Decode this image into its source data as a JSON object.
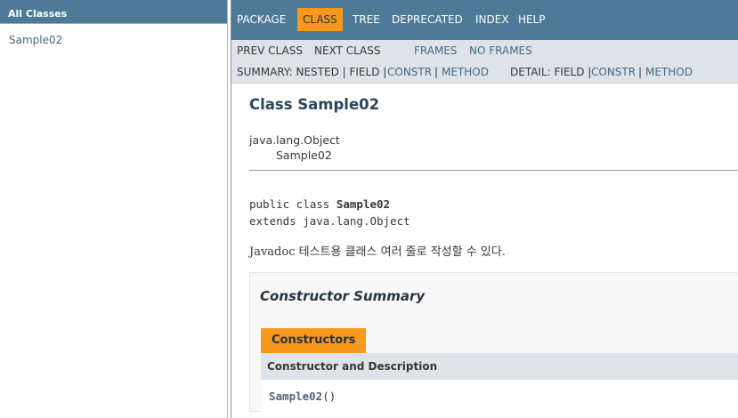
{
  "sidebar": {
    "title": "All Classes",
    "classes": [
      "Sample02"
    ]
  },
  "nav": {
    "items": [
      "PACKAGE",
      "CLASS",
      "TREE",
      "DEPRECATED",
      "INDEX",
      "HELP"
    ],
    "active": "CLASS"
  },
  "subnav": {
    "prev_class": "PREV CLASS",
    "next_class": "NEXT CLASS",
    "frames": "FRAMES",
    "no_frames": "NO FRAMES",
    "summary_label": "SUMMARY: NESTED | FIELD |",
    "summary_constr": "CONSTR",
    "summary_sep": "|",
    "summary_method": "METHOD",
    "detail_label": "DETAIL: FIELD |",
    "detail_constr": "CONSTR",
    "detail_sep": "|",
    "detail_method": "METHOD"
  },
  "content": {
    "class_title": "Class Sample02",
    "inherit_parent": "java.lang.Object",
    "inherit_child": "Sample02",
    "sig_line1_prefix": "public class ",
    "sig_line1_name": "Sample02",
    "sig_line2": "extends java.lang.Object",
    "description": "Javadoc 테스트용 클래스 여러 줄로 작성할 수 있다."
  },
  "constructor_summary": {
    "title": "Constructor Summary",
    "tab": "Constructors",
    "column": "Constructor and Description",
    "rows": [
      {
        "name": "Sample02",
        "params": "()"
      }
    ]
  },
  "colors": {
    "nav_bg": "#4d7a97",
    "active_tab": "#f8981d",
    "subnav_bg": "#dee3e9",
    "link": "#4a6782"
  }
}
